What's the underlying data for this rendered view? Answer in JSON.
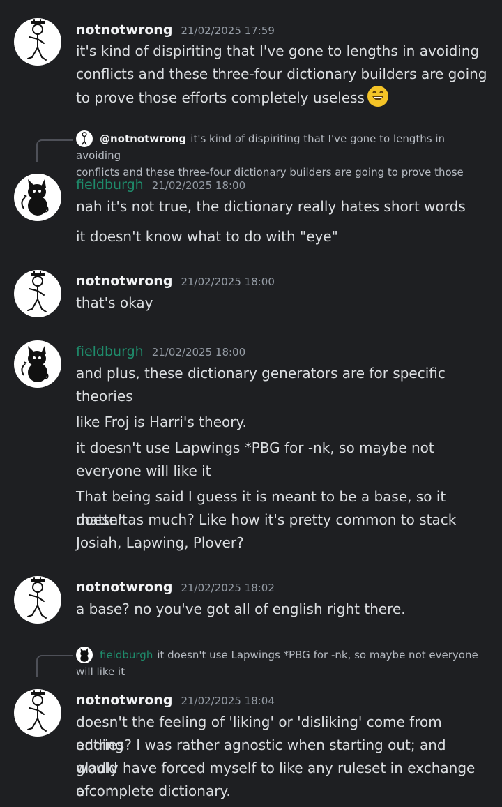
{
  "messages": [
    {
      "username": "notnotwrong",
      "timestamp": "21/02/2025 17:59",
      "lines": [
        "it's kind of dispiriting that I've gone to lengths in avoiding",
        "conflicts and these three-four dictionary builders are going",
        "to prove those efforts completely useless"
      ],
      "emoji": "grinning-face"
    },
    {
      "reply": {
        "mention": "@notnotwrong",
        "line1": "it's kind of dispiriting that I've gone to lengths in avoiding",
        "line2": "conflicts and these three-four dictionary builders are going to prove those"
      },
      "username": "fieldburgh",
      "timestamp": "21/02/2025 18:00",
      "lines": [
        "nah it's not true, the dictionary really hates short words",
        "it doesn't know what to do with \"eye\""
      ]
    },
    {
      "username": "notnotwrong",
      "timestamp": "21/02/2025 18:00",
      "lines": [
        "that's okay"
      ]
    },
    {
      "username": "fieldburgh",
      "timestamp": "21/02/2025 18:00",
      "lines": [
        "and plus, these dictionary generators are for specific",
        "theories",
        "like Froj is Harri's theory.",
        "it doesn't use Lapwings *PBG for -nk, so maybe not",
        "everyone will like it",
        "That being said I guess it is meant to be a base, so it doesn't",
        "matter as much? Like how it's pretty common to stack",
        "Josiah, Lapwing, Plover?"
      ]
    },
    {
      "username": "notnotwrong",
      "timestamp": "21/02/2025 18:02",
      "lines": [
        "a base? no you've got all of english right there."
      ]
    },
    {
      "reply": {
        "mention": "fieldburgh",
        "line1": "it doesn't use Lapwings *PBG for -nk, so maybe not everyone",
        "line2": "will like it"
      },
      "username": "notnotwrong",
      "timestamp": "21/02/2025 18:04",
      "lines": [
        "doesn't the feeling of 'liking' or 'disliking' come from adding",
        "entries? I was rather agnostic when starting out; and would",
        "gladly have forced myself to like any ruleset in exchange of",
        "a complete dictionary."
      ]
    }
  ]
}
